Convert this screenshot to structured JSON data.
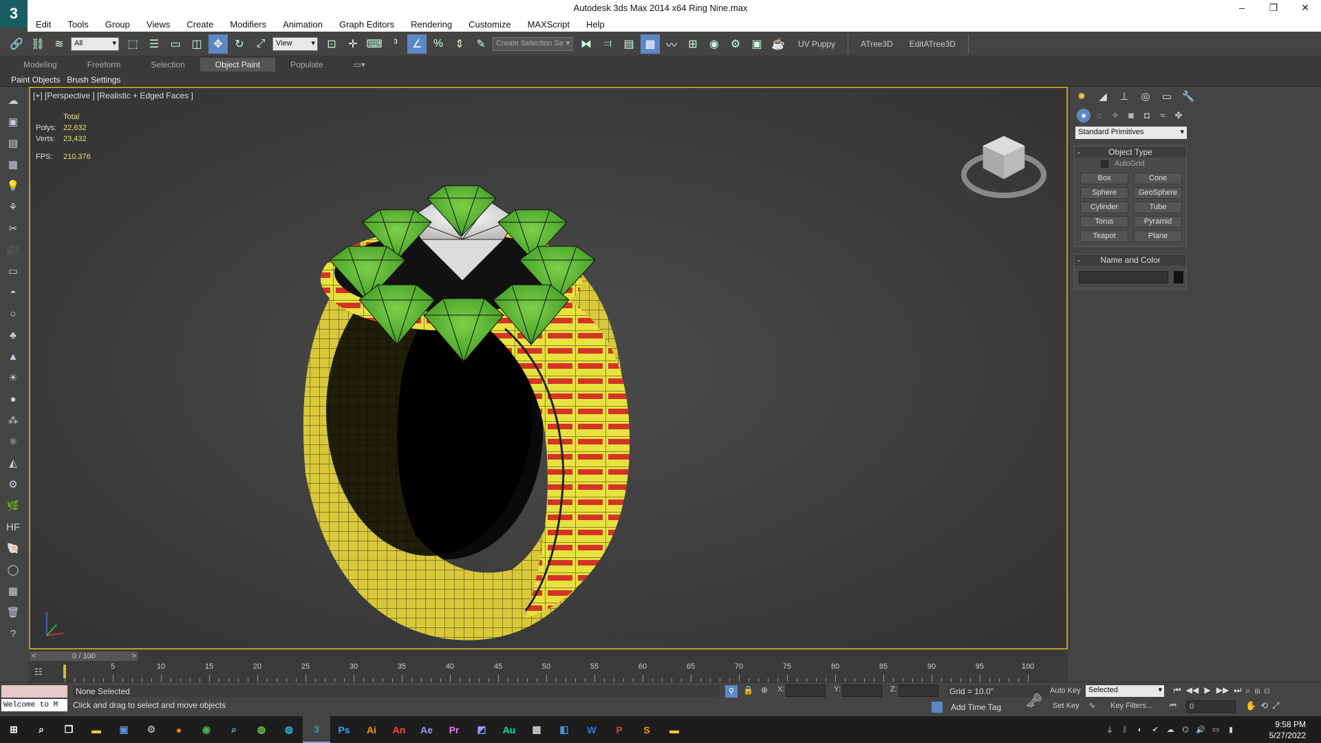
{
  "window": {
    "title": "Autodesk 3ds Max  2014 x64     Ring Nine.max",
    "logo": "3ds-max-logo"
  },
  "menu": [
    "Edit",
    "Tools",
    "Group",
    "Views",
    "Create",
    "Modifiers",
    "Animation",
    "Graph Editors",
    "Rendering",
    "Customize",
    "MAXScript",
    "Help"
  ],
  "toolbar": {
    "selection_filter": "All",
    "ref_coord": "View",
    "named_selection": "Create Selection Se",
    "uv_puppy": "UV Puppy",
    "atree": "ATree3D",
    "editatree": "EditATree3D"
  },
  "ribbon": {
    "tabs": [
      "Modeling",
      "Freeform",
      "Selection",
      "Object Paint",
      "Populate"
    ],
    "active": "Object Paint",
    "sub": [
      "Paint Objects",
      "Brush Settings"
    ]
  },
  "viewport": {
    "label": "[+] [Perspective ] [Realistic + Edged Faces ]",
    "stats": {
      "header": "Total",
      "polys_label": "Polys:",
      "polys": "22,632",
      "verts_label": "Verts:",
      "verts": "23,432",
      "fps_label": "FPS:",
      "fps": "210.376"
    }
  },
  "command_panel": {
    "category": "Standard Primitives",
    "object_type_title": "Object Type",
    "autogrid": "AutoGrid",
    "buttons": [
      "Box",
      "Cone",
      "Sphere",
      "GeoSphere",
      "Cylinder",
      "Tube",
      "Torus",
      "Pyramid",
      "Teapot",
      "Plane"
    ],
    "name_color_title": "Name and Color",
    "color": "#111111"
  },
  "timeline": {
    "frame": "0 / 100",
    "ticks": [
      "5",
      "10",
      "15",
      "20",
      "25",
      "30",
      "35",
      "40",
      "45",
      "50",
      "55",
      "60",
      "65",
      "70",
      "75",
      "80",
      "85",
      "90",
      "95",
      "100"
    ]
  },
  "status": {
    "maxscript": "Welcome to M",
    "selection": "None Selected",
    "prompt": "Click and drag to select and move objects",
    "x": "X:",
    "y": "Y:",
    "z": "Z:",
    "grid": "Grid = 10.0\"",
    "add_time_tag": "Add Time Tag",
    "auto_key": "Auto Key",
    "set_key": "Set Key",
    "key_mode": "Selected",
    "key_filters": "Key Filters...",
    "current_frame": "0"
  },
  "taskbar": {
    "apps": [
      "File Explorer",
      "3ds Max",
      "Photoshop",
      "Illustrator",
      "Animate",
      "After Effects",
      "Premiere",
      "Audition",
      "Word",
      "PowerPoint"
    ],
    "time": "9:58 PM",
    "date": "5/27/2022"
  }
}
